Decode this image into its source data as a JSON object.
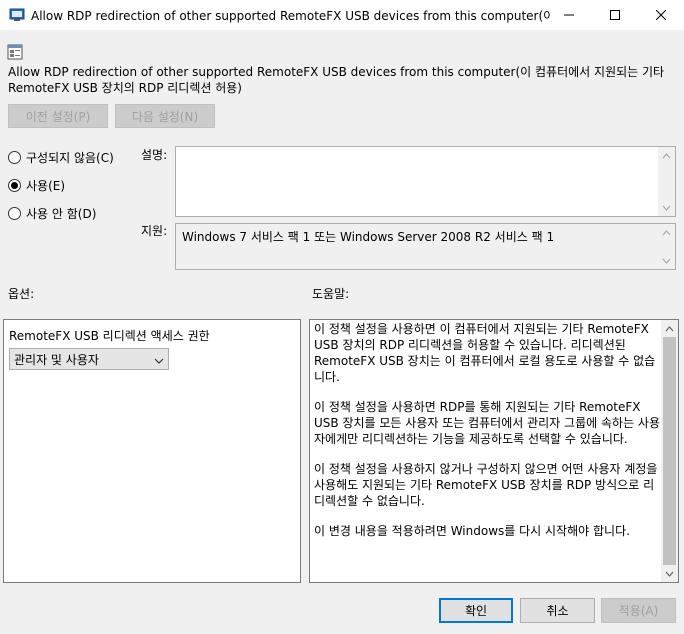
{
  "window": {
    "title": "Allow RDP redirection of other supported RemoteFX USB devices from this computer(이 컴퓨...",
    "icon": "policy-app-icon",
    "controls": [
      "minimize-icon",
      "maximize-icon",
      "close-icon"
    ]
  },
  "policy": {
    "icon": "policy-setting-icon",
    "title": "Allow RDP redirection of other supported RemoteFX USB devices from this computer(이 컴퓨터에서 지원되는 기타 RemoteFX USB 장치의 RDP 리디렉션 허용)"
  },
  "nav": {
    "prev_label": "이전 설정(P)",
    "next_label": "다음 설정(N)"
  },
  "state": {
    "options": [
      {
        "label": "구성되지 않음(C)",
        "checked": false
      },
      {
        "label": "사용(E)",
        "checked": true
      },
      {
        "label": "사용 안 함(D)",
        "checked": false
      }
    ]
  },
  "comment": {
    "label": "설명:",
    "value": ""
  },
  "supported": {
    "label": "지원:",
    "value": "Windows 7 서비스 팩 1 또는 Windows Server 2008 R2 서비스 팩 1"
  },
  "options_section": {
    "label": "옵션:",
    "field_label": "RemoteFX USB 리디렉션 액세스 권한",
    "selected_value": "관리자 및 사용자"
  },
  "help_section": {
    "label": "도움말:",
    "paragraphs": [
      "이 정책 설정을 사용하면 이 컴퓨터에서 지원되는 기타 RemoteFX USB 장치의 RDP 리디렉션을 허용할 수 있습니다. 리디렉션된 RemoteFX USB 장치는 이 컴퓨터에서 로컬 용도로 사용할 수 없습니다.",
      "이 정책 설정을 사용하면 RDP를 통해 지원되는 기타 RemoteFX USB 장치를 모든 사용자 또는 컴퓨터에서 관리자 그룹에 속하는 사용자에게만 리디렉션하는 기능을 제공하도록 선택할 수 있습니다.",
      "이 정책 설정을 사용하지 않거나 구성하지 않으면 어떤 사용자 계정을 사용해도 지원되는 기타 RemoteFX USB 장치를 RDP 방식으로 리디렉션할 수 없습니다.",
      "이 변경 내용을 적용하려면 Windows를 다시 시작해야 합니다."
    ]
  },
  "footer": {
    "ok_label": "확인",
    "cancel_label": "취소",
    "apply_label": "적용(A)"
  }
}
